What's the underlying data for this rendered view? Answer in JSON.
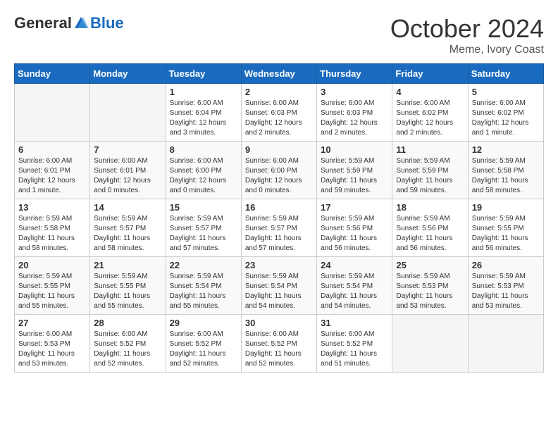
{
  "header": {
    "logo_general": "General",
    "logo_blue": "Blue",
    "month": "October 2024",
    "location": "Meme, Ivory Coast"
  },
  "weekdays": [
    "Sunday",
    "Monday",
    "Tuesday",
    "Wednesday",
    "Thursday",
    "Friday",
    "Saturday"
  ],
  "weeks": [
    [
      {
        "day": "",
        "info": ""
      },
      {
        "day": "",
        "info": ""
      },
      {
        "day": "1",
        "info": "Sunrise: 6:00 AM\nSunset: 6:04 PM\nDaylight: 12 hours and 3 minutes."
      },
      {
        "day": "2",
        "info": "Sunrise: 6:00 AM\nSunset: 6:03 PM\nDaylight: 12 hours and 2 minutes."
      },
      {
        "day": "3",
        "info": "Sunrise: 6:00 AM\nSunset: 6:03 PM\nDaylight: 12 hours and 2 minutes."
      },
      {
        "day": "4",
        "info": "Sunrise: 6:00 AM\nSunset: 6:02 PM\nDaylight: 12 hours and 2 minutes."
      },
      {
        "day": "5",
        "info": "Sunrise: 6:00 AM\nSunset: 6:02 PM\nDaylight: 12 hours and 1 minute."
      }
    ],
    [
      {
        "day": "6",
        "info": "Sunrise: 6:00 AM\nSunset: 6:01 PM\nDaylight: 12 hours and 1 minute."
      },
      {
        "day": "7",
        "info": "Sunrise: 6:00 AM\nSunset: 6:01 PM\nDaylight: 12 hours and 0 minutes."
      },
      {
        "day": "8",
        "info": "Sunrise: 6:00 AM\nSunset: 6:00 PM\nDaylight: 12 hours and 0 minutes."
      },
      {
        "day": "9",
        "info": "Sunrise: 6:00 AM\nSunset: 6:00 PM\nDaylight: 12 hours and 0 minutes."
      },
      {
        "day": "10",
        "info": "Sunrise: 5:59 AM\nSunset: 5:59 PM\nDaylight: 11 hours and 59 minutes."
      },
      {
        "day": "11",
        "info": "Sunrise: 5:59 AM\nSunset: 5:59 PM\nDaylight: 11 hours and 59 minutes."
      },
      {
        "day": "12",
        "info": "Sunrise: 5:59 AM\nSunset: 5:58 PM\nDaylight: 11 hours and 58 minutes."
      }
    ],
    [
      {
        "day": "13",
        "info": "Sunrise: 5:59 AM\nSunset: 5:58 PM\nDaylight: 11 hours and 58 minutes."
      },
      {
        "day": "14",
        "info": "Sunrise: 5:59 AM\nSunset: 5:57 PM\nDaylight: 11 hours and 58 minutes."
      },
      {
        "day": "15",
        "info": "Sunrise: 5:59 AM\nSunset: 5:57 PM\nDaylight: 11 hours and 57 minutes."
      },
      {
        "day": "16",
        "info": "Sunrise: 5:59 AM\nSunset: 5:57 PM\nDaylight: 11 hours and 57 minutes."
      },
      {
        "day": "17",
        "info": "Sunrise: 5:59 AM\nSunset: 5:56 PM\nDaylight: 11 hours and 56 minutes."
      },
      {
        "day": "18",
        "info": "Sunrise: 5:59 AM\nSunset: 5:56 PM\nDaylight: 11 hours and 56 minutes."
      },
      {
        "day": "19",
        "info": "Sunrise: 5:59 AM\nSunset: 5:55 PM\nDaylight: 11 hours and 56 minutes."
      }
    ],
    [
      {
        "day": "20",
        "info": "Sunrise: 5:59 AM\nSunset: 5:55 PM\nDaylight: 11 hours and 55 minutes."
      },
      {
        "day": "21",
        "info": "Sunrise: 5:59 AM\nSunset: 5:55 PM\nDaylight: 11 hours and 55 minutes."
      },
      {
        "day": "22",
        "info": "Sunrise: 5:59 AM\nSunset: 5:54 PM\nDaylight: 11 hours and 55 minutes."
      },
      {
        "day": "23",
        "info": "Sunrise: 5:59 AM\nSunset: 5:54 PM\nDaylight: 11 hours and 54 minutes."
      },
      {
        "day": "24",
        "info": "Sunrise: 5:59 AM\nSunset: 5:54 PM\nDaylight: 11 hours and 54 minutes."
      },
      {
        "day": "25",
        "info": "Sunrise: 5:59 AM\nSunset: 5:53 PM\nDaylight: 11 hours and 53 minutes."
      },
      {
        "day": "26",
        "info": "Sunrise: 5:59 AM\nSunset: 5:53 PM\nDaylight: 11 hours and 53 minutes."
      }
    ],
    [
      {
        "day": "27",
        "info": "Sunrise: 6:00 AM\nSunset: 5:53 PM\nDaylight: 11 hours and 53 minutes."
      },
      {
        "day": "28",
        "info": "Sunrise: 6:00 AM\nSunset: 5:52 PM\nDaylight: 11 hours and 52 minutes."
      },
      {
        "day": "29",
        "info": "Sunrise: 6:00 AM\nSunset: 5:52 PM\nDaylight: 11 hours and 52 minutes."
      },
      {
        "day": "30",
        "info": "Sunrise: 6:00 AM\nSunset: 5:52 PM\nDaylight: 11 hours and 52 minutes."
      },
      {
        "day": "31",
        "info": "Sunrise: 6:00 AM\nSunset: 5:52 PM\nDaylight: 11 hours and 51 minutes."
      },
      {
        "day": "",
        "info": ""
      },
      {
        "day": "",
        "info": ""
      }
    ]
  ]
}
